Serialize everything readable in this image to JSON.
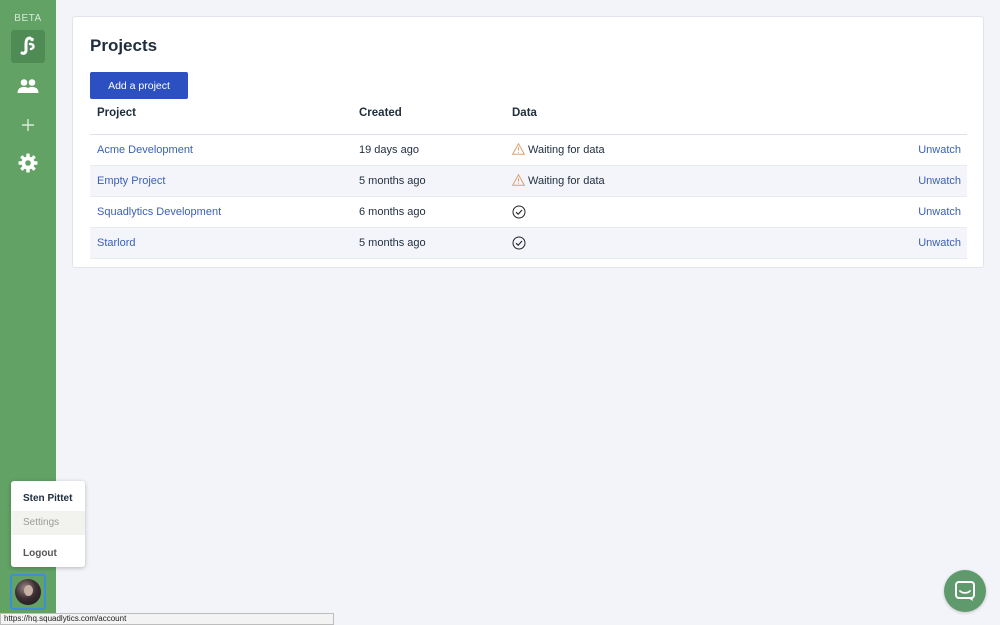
{
  "sidebar": {
    "beta_label": "BETA",
    "items": [
      {
        "name": "logo",
        "icon": "squadlytics-logo-icon"
      },
      {
        "name": "team",
        "icon": "people-icon"
      },
      {
        "name": "add",
        "icon": "plus-icon"
      },
      {
        "name": "settings",
        "icon": "gear-icon"
      }
    ],
    "bg_color": "#62a265"
  },
  "user_menu": {
    "user_name": "Sten Pittet",
    "settings_label": "Settings",
    "logout_label": "Logout"
  },
  "main": {
    "title": "Projects",
    "add_button_label": "Add a project",
    "columns": [
      "Project",
      "Created",
      "Data"
    ],
    "rows": [
      {
        "project": "Acme Development",
        "created": "19 days ago",
        "data_status": "warning",
        "data_text": "Waiting for data",
        "action": "Unwatch"
      },
      {
        "project": "Empty Project",
        "created": "5 months ago",
        "data_status": "warning",
        "data_text": "Waiting for data",
        "action": "Unwatch"
      },
      {
        "project": "Squadlytics Development",
        "created": "6 months ago",
        "data_status": "ok",
        "data_text": "",
        "action": "Unwatch"
      },
      {
        "project": "Starlord",
        "created": "5 months ago",
        "data_status": "ok",
        "data_text": "",
        "action": "Unwatch"
      }
    ]
  },
  "status_bar": {
    "url": "https://hq.squadlytics.com/account"
  },
  "chat": {
    "icon": "chat-icon"
  }
}
